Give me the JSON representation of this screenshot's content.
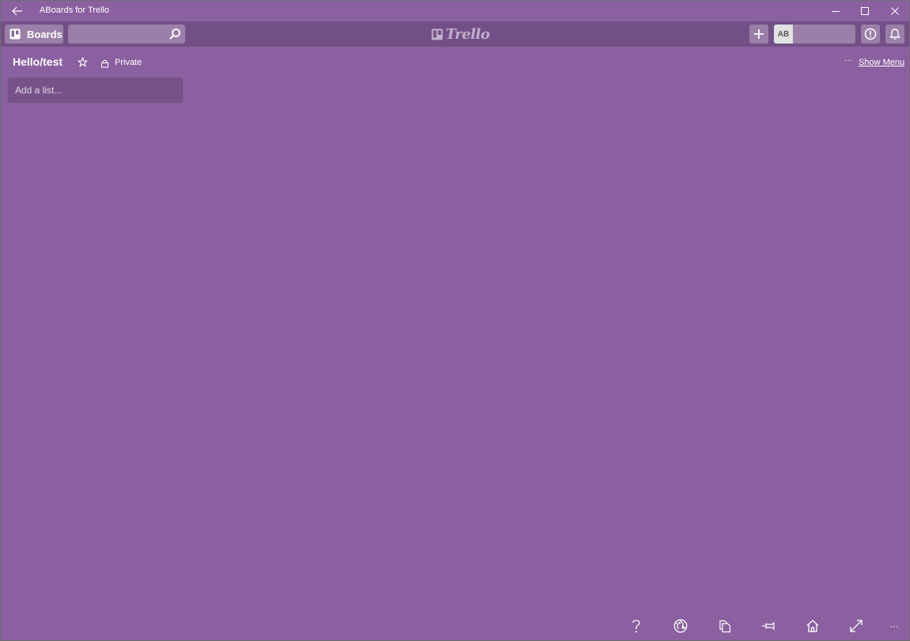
{
  "window": {
    "title": "ABoards for Trello"
  },
  "header": {
    "boards_label": "Boards",
    "search_placeholder": "",
    "logo_text": "Trello",
    "avatar_initials": "AB"
  },
  "board": {
    "title": "Hello/test",
    "privacy": "Private",
    "menu_dots": "···",
    "show_menu_label": "Show Menu",
    "add_list_label": "Add a list..."
  },
  "appbar": {
    "icons": [
      "help-icon",
      "globe-icon",
      "copy-icon",
      "pin-icon",
      "home-icon",
      "fullscreen-icon",
      "more-icon"
    ],
    "more_label": "···"
  },
  "colors": {
    "board_background": "#8a60a0",
    "header_background": "#734f87",
    "text": "#ffffff"
  }
}
